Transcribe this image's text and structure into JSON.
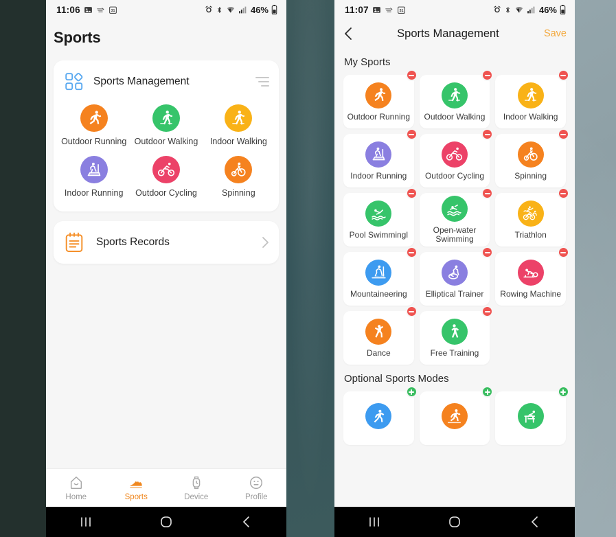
{
  "left_phone": {
    "status_bar": {
      "time": "11:06",
      "left_icons": [
        "photo-icon",
        "motion-icon",
        "calendar-31-icon"
      ],
      "right_icons": [
        "alarm-icon",
        "bluetooth-icon",
        "wifi-icon",
        "signal-icon"
      ],
      "battery_text": "46%",
      "battery_icon": "battery-icon"
    },
    "page_title": "Sports",
    "management_card": {
      "icon": "grid-apps-icon",
      "title": "Sports Management",
      "menu_icon": "hamburger-menu-icon",
      "sports": [
        {
          "label": "Outdoor Running",
          "icon": "running-icon",
          "color": "#f5821f"
        },
        {
          "label": "Outdoor Walking",
          "icon": "walking-icon",
          "color": "#36c46a"
        },
        {
          "label": "Indoor Walking",
          "icon": "walking-icon",
          "color": "#f9b217"
        },
        {
          "label": "Indoor Running",
          "icon": "treadmill-icon",
          "color": "#8a7fe0"
        },
        {
          "label": "Outdoor Cycling",
          "icon": "cycling-icon",
          "color": "#ec4268"
        },
        {
          "label": "Spinning",
          "icon": "spinning-icon",
          "color": "#f5821f"
        }
      ]
    },
    "records_card": {
      "icon": "clipboard-icon",
      "label": "Sports Records",
      "chevron": "chevron-right-icon"
    },
    "tab_bar": {
      "active": "Sports",
      "active_color": "#f08820",
      "inactive_color": "#9a9a9a",
      "tabs": [
        {
          "label": "Home",
          "icon": "home-icon"
        },
        {
          "label": "Sports",
          "icon": "shoe-icon"
        },
        {
          "label": "Device",
          "icon": "watch-icon"
        },
        {
          "label": "Profile",
          "icon": "face-icon"
        }
      ]
    },
    "android_nav": [
      "recents-icon",
      "home-circle-icon",
      "back-icon"
    ]
  },
  "right_phone": {
    "status_bar": {
      "time": "11:07",
      "left_icons": [
        "photo-icon",
        "motion-icon",
        "calendar-31-icon"
      ],
      "right_icons": [
        "alarm-icon",
        "bluetooth-icon",
        "wifi-icon",
        "signal-icon"
      ],
      "battery_text": "46%",
      "battery_icon": "battery-icon"
    },
    "header": {
      "back_icon": "chevron-left-icon",
      "title": "Sports Management",
      "save_label": "Save",
      "save_color": "#f3a83c"
    },
    "my_sports": {
      "section_title": "My Sports",
      "badge_action": "remove",
      "badge_color": "#ef5350",
      "items": [
        {
          "label": "Outdoor Running",
          "icon": "running-icon",
          "color": "#f5821f"
        },
        {
          "label": "Outdoor Walking",
          "icon": "walking-icon",
          "color": "#36c46a"
        },
        {
          "label": "Indoor Walking",
          "icon": "walking-icon",
          "color": "#f9b217"
        },
        {
          "label": "Indoor Running",
          "icon": "treadmill-icon",
          "color": "#8a7fe0"
        },
        {
          "label": "Outdoor Cycling",
          "icon": "cycling-icon",
          "color": "#ec4268"
        },
        {
          "label": "Spinning",
          "icon": "spinning-icon",
          "color": "#f5821f"
        },
        {
          "label": "Pool Swimmingl",
          "icon": "swimming-icon",
          "color": "#36c46a"
        },
        {
          "label": "Open-water Swimming",
          "icon": "openwater-icon",
          "color": "#36c46a"
        },
        {
          "label": "Triathlon",
          "icon": "triathlon-icon",
          "color": "#f9b217"
        },
        {
          "label": "Mountaineering",
          "icon": "hiking-icon",
          "color": "#3d9bf0"
        },
        {
          "label": "Elliptical Trainer",
          "icon": "elliptical-icon",
          "color": "#8a7fe0"
        },
        {
          "label": "Rowing Machine",
          "icon": "rowing-icon",
          "color": "#ec4268"
        },
        {
          "label": "Dance",
          "icon": "dance-icon",
          "color": "#f5821f"
        },
        {
          "label": "Free Training",
          "icon": "freetrain-icon",
          "color": "#36c46a"
        }
      ]
    },
    "optional_sports": {
      "section_title": "Optional Sports Modes",
      "badge_action": "add",
      "badge_color": "#39bd5f",
      "items": [
        {
          "label": "",
          "icon": "stretch-icon",
          "color": "#3d9bf0"
        },
        {
          "label": "",
          "icon": "trailrun-icon",
          "color": "#f5821f"
        },
        {
          "label": "",
          "icon": "hurdles-icon",
          "color": "#36c46a"
        }
      ]
    },
    "android_nav": [
      "recents-icon",
      "home-circle-icon",
      "back-icon"
    ]
  }
}
